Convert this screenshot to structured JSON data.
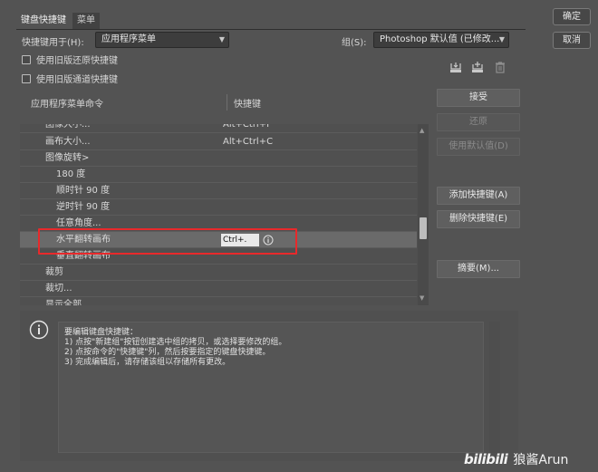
{
  "tabs": [
    {
      "label": "键盘快捷键"
    },
    {
      "label": "菜单"
    }
  ],
  "shortcuts_for": {
    "label": "快捷键用于(H):",
    "value": "应用程序菜单"
  },
  "set": {
    "label": "组(S):",
    "value": "Photoshop 默认值 (已修改..."
  },
  "checkboxes": [
    {
      "label": "使用旧版还原快捷键"
    },
    {
      "label": "使用旧版通道快捷键"
    }
  ],
  "toolbar": {
    "icons": [
      "save-set-icon",
      "new-set-icon",
      "delete-set-icon"
    ]
  },
  "table": {
    "headers": {
      "command": "应用程序菜单命令",
      "shortcut": "快捷键"
    },
    "rows": [
      {
        "command": "图像大小...",
        "shortcut": "Alt+Ctrl+I",
        "indent": 1
      },
      {
        "command": "画布大小...",
        "shortcut": "Alt+Ctrl+C",
        "indent": 1
      },
      {
        "command": "图像旋转>",
        "shortcut": "",
        "indent": 1
      },
      {
        "command": "180 度",
        "shortcut": "",
        "indent": 2
      },
      {
        "command": "顺时针 90 度",
        "shortcut": "",
        "indent": 2
      },
      {
        "command": "逆时针 90 度",
        "shortcut": "",
        "indent": 2
      },
      {
        "command": "任意角度...",
        "shortcut": "",
        "indent": 2
      },
      {
        "command": "水平翻转画布",
        "shortcut": "Ctrl+.",
        "indent": 2,
        "selected": true
      },
      {
        "command": "垂直翻转画布",
        "shortcut": "",
        "indent": 2
      },
      {
        "command": "裁剪",
        "shortcut": "",
        "indent": 0
      },
      {
        "command": "裁切...",
        "shortcut": "",
        "indent": 0
      },
      {
        "command": "显示全部",
        "shortcut": "",
        "indent": 0
      }
    ]
  },
  "buttons": {
    "ok": "确定",
    "cancel": "取消",
    "accept": "接受",
    "undo": "还原",
    "use_default": "使用默认值(D)",
    "add_shortcut": "添加快捷键(A)",
    "delete_shortcut": "删除快捷键(E)",
    "summarize": "摘要(M)..."
  },
  "info": {
    "lines": [
      "要编辑键盘快捷键：",
      "1) 点按\"新建组\"按钮创建选中组的拷贝，或选择要修改的组。",
      "2) 点按命令的\"快捷键\"列，然后按要指定的键盘快捷键。",
      "3) 完成编辑后，请存储该组以存储所有更改。"
    ]
  },
  "watermark": {
    "logo": "bilibili",
    "user": "狼酱Arun"
  },
  "colors": {
    "highlight": "#e8292b",
    "background": "#535353"
  }
}
